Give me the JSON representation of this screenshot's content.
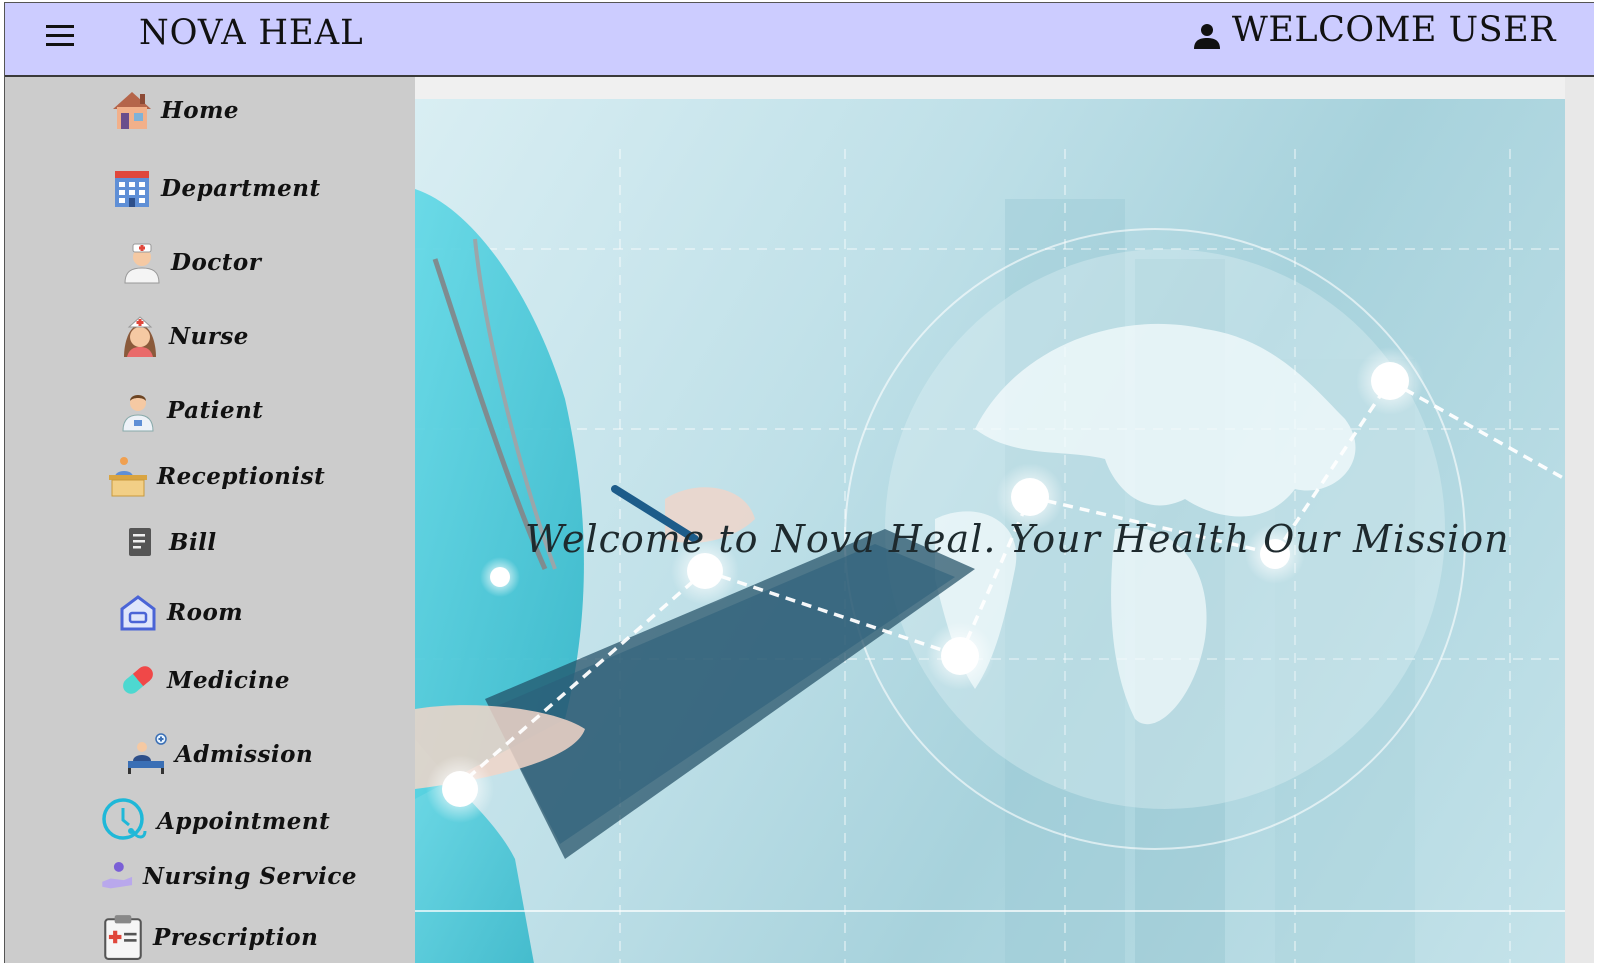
{
  "header": {
    "app_title": "NOVA HEAL",
    "welcome_text": "WELCOME USER",
    "menu_icon": "hamburger-menu-icon",
    "user_icon": "user-icon",
    "background": "#ccccff"
  },
  "sidebar": {
    "background": "#cccccc",
    "items": [
      {
        "label": "Home",
        "icon": "home-icon"
      },
      {
        "label": "Department",
        "icon": "hospital-building-icon"
      },
      {
        "label": "Doctor",
        "icon": "doctor-icon"
      },
      {
        "label": "Nurse",
        "icon": "nurse-icon"
      },
      {
        "label": "Patient",
        "icon": "patient-icon"
      },
      {
        "label": "Receptionist",
        "icon": "receptionist-desk-icon"
      },
      {
        "label": "Bill",
        "icon": "bill-icon"
      },
      {
        "label": "Room",
        "icon": "room-icon"
      },
      {
        "label": "Medicine",
        "icon": "pill-capsule-icon"
      },
      {
        "label": "Admission",
        "icon": "hospital-bed-icon"
      },
      {
        "label": "Appointment",
        "icon": "clock-stethoscope-icon"
      },
      {
        "label": "Nursing Service",
        "icon": "care-hand-icon"
      },
      {
        "label": "Prescription",
        "icon": "clipboard-prescription-icon"
      }
    ]
  },
  "main": {
    "hero_text": "Welcome to Nova Heal. Your Health Our Mission"
  }
}
